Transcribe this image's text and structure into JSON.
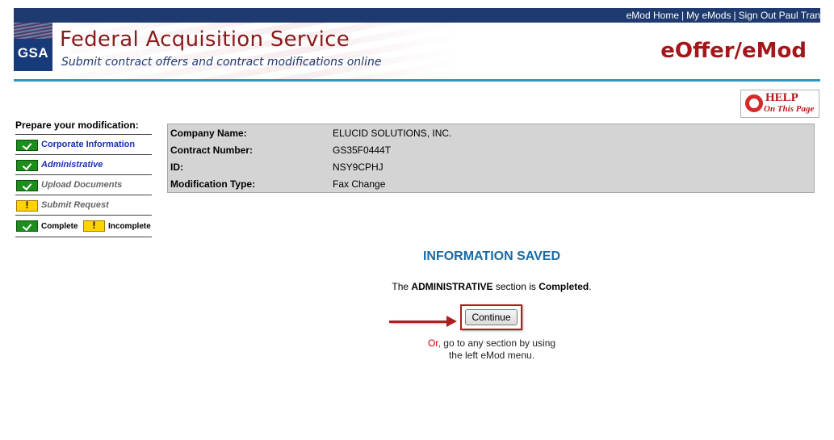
{
  "topnav": {
    "links": [
      "eMod Home",
      "My eMods",
      "Sign Out Paul Tran"
    ],
    "separator": "|"
  },
  "header": {
    "logo_text": "GSA",
    "agency_title": "Federal Acquisition Service",
    "tagline": "Submit contract offers and contract modifications online",
    "app_title": "eOffer/eMod",
    "colors": {
      "navbar": "#1f3a6e",
      "title": "#8b1a1a",
      "accent_rule": "#2d96c4",
      "app_title": "#a5161a"
    }
  },
  "help": {
    "title": "HELP",
    "subtitle": "On This Page",
    "icon": "life-ring-icon"
  },
  "leftnav": {
    "title": "Prepare your modification:",
    "items": [
      {
        "label": "Corporate Information",
        "status": "complete",
        "icon": "check-icon"
      },
      {
        "label": "Administrative",
        "status": "complete",
        "icon": "check-icon"
      },
      {
        "label": "Upload Documents",
        "status": "complete",
        "icon": "check-icon"
      },
      {
        "label": "Submit Request",
        "status": "incomplete",
        "icon": "exclamation-icon"
      }
    ],
    "legend": {
      "complete": "Complete",
      "incomplete": "Incomplete"
    }
  },
  "info": {
    "rows": [
      {
        "key": "Company Name:",
        "value": "ELUCID SOLUTIONS, INC."
      },
      {
        "key": "Contract Number:",
        "value": "GS35F0444T"
      },
      {
        "key": "ID:",
        "value": "NSY9CPHJ"
      },
      {
        "key": "Modification Type:",
        "value": "Fax Change"
      }
    ]
  },
  "main": {
    "heading": "INFORMATION SAVED",
    "msg_prefix": "The",
    "msg_section": "ADMINISTRATIVE",
    "msg_middle": "section is",
    "msg_status": "Completed",
    "msg_end": ".",
    "continue_label": "Continue",
    "or_word": "Or,",
    "or_rest": "go to any section by using",
    "or_line2": "the left eMod menu."
  }
}
